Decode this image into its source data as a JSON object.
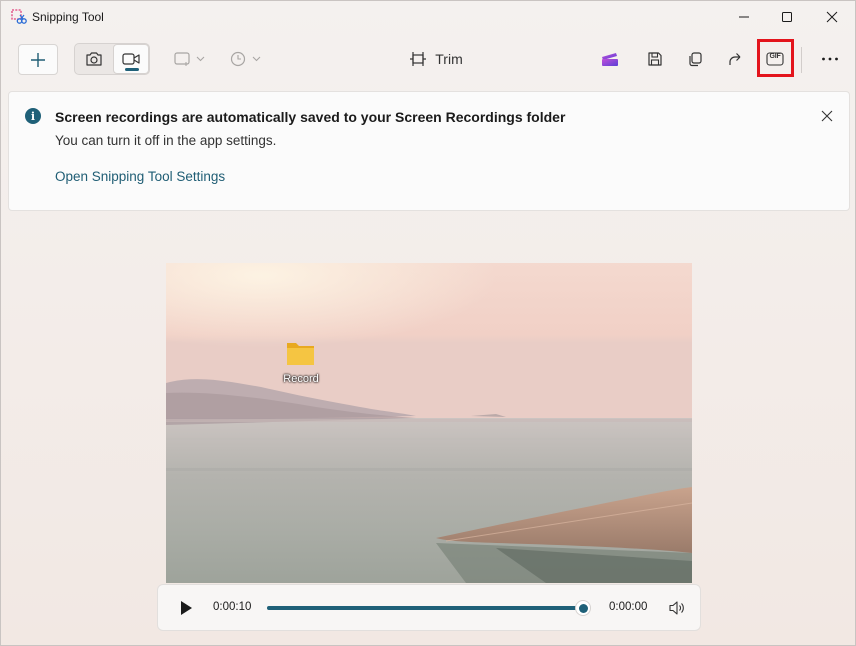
{
  "app": {
    "title": "Snipping Tool"
  },
  "toolbar": {
    "trim_label": "Trim",
    "gif_label": "GIF"
  },
  "banner": {
    "title": "Screen recordings are automatically saved to your Screen Recordings folder",
    "message": "You can turn it off in the app settings.",
    "link": "Open Snipping Tool Settings"
  },
  "preview": {
    "desktop_icon_label": "Record"
  },
  "player": {
    "current_time": "0:00:10",
    "end_time": "0:00:00",
    "progress": 1.0
  },
  "colors": {
    "accent": "#1f6078",
    "highlight_box": "#e3141c",
    "folder": "#f5c542"
  }
}
